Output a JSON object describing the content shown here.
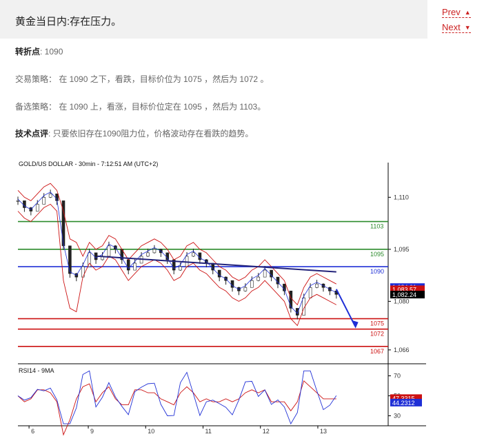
{
  "header": {
    "title": "黄金当日内:存在压力。",
    "prev_label": "Prev",
    "next_label": "Next"
  },
  "content": {
    "pivot_label": "转折点",
    "pivot_value": ": 1090",
    "strategy_label": "交易策略",
    "strategy_text": "： 在 1090 之下，看跌，目标价位为 1075 ，然后为 1072 。",
    "alt_label": "备选策略",
    "alt_text": "： 在 1090 上，看涨，目标价位定在 1095 ，然后为 1103。",
    "comment_label": "技术点评",
    "comment_text": ": 只要依旧存在1090阻力位，价格波动存在看跌的趋势。"
  },
  "chart_data": {
    "type": "candlestick",
    "title": "GOLD/US DOLLAR - 30min - 7:12:51 AM (UTC+2)",
    "ylim": [
      1062,
      1120
    ],
    "yticks": [
      1110,
      1095,
      1080,
      1066
    ],
    "ytick_labels": [
      "1,110",
      "1,095",
      "1,080",
      "1,066"
    ],
    "x_labels": [
      "6",
      "9",
      "10",
      "11",
      "12",
      "13"
    ],
    "levels": [
      {
        "value": 1103,
        "label": "1103",
        "color": "#2a8a2a"
      },
      {
        "value": 1095,
        "label": "1095",
        "color": "#2a8a2a"
      },
      {
        "value": 1090,
        "label": "1090",
        "color": "#1f2fd6"
      },
      {
        "value": 1075,
        "label": "1075",
        "color": "#cc1111"
      },
      {
        "value": 1072,
        "label": "1072",
        "color": "#cc1111"
      },
      {
        "value": 1067,
        "label": "1067",
        "color": "#cc1111"
      }
    ],
    "price_tags": [
      {
        "label": "1,084.01",
        "value": 1084.01,
        "bg": "#1f2fd6",
        "fg": "#ffffff"
      },
      {
        "label": "1,083.57",
        "value": 1083.57,
        "bg": "#cc1111",
        "fg": "#ffffff"
      },
      {
        "label": "1,082.24",
        "value": 1082.24,
        "bg": "#000000",
        "fg": "#ffffff"
      }
    ],
    "price_path": [
      1109,
      1107,
      1106,
      1108,
      1110,
      1111,
      1109,
      1096,
      1088,
      1087,
      1090,
      1094,
      1092,
      1093,
      1096,
      1095,
      1092,
      1089,
      1091,
      1093,
      1094,
      1095,
      1094,
      1092,
      1089,
      1090,
      1093,
      1094,
      1092,
      1091,
      1089,
      1087,
      1086,
      1084,
      1083,
      1084,
      1086,
      1087,
      1089,
      1087,
      1085,
      1083,
      1078,
      1076,
      1081,
      1084,
      1085,
      1084,
      1083,
      1082
    ],
    "trendline": {
      "from": [
        0.215,
        1093
      ],
      "to": [
        0.86,
        1088.5
      ]
    },
    "projection": {
      "from": [
        0.86,
        1083.5
      ],
      "to": [
        0.91,
        1073
      ],
      "color": "#1f2fd6"
    },
    "rsi": {
      "title": "RSI14 - 9MA",
      "ylim": [
        20,
        80
      ],
      "yticks": [
        70,
        50,
        30
      ],
      "ytick_labels": [
        "70",
        "50",
        "30"
      ],
      "tags": [
        {
          "label": "47.3315",
          "value": 47.33,
          "bg": "#cc1111",
          "fg": "#ffffff"
        },
        {
          "label": "44.2312",
          "value": 44.23,
          "bg": "#1f2fd6",
          "fg": "#ffffff"
        }
      ]
    }
  }
}
